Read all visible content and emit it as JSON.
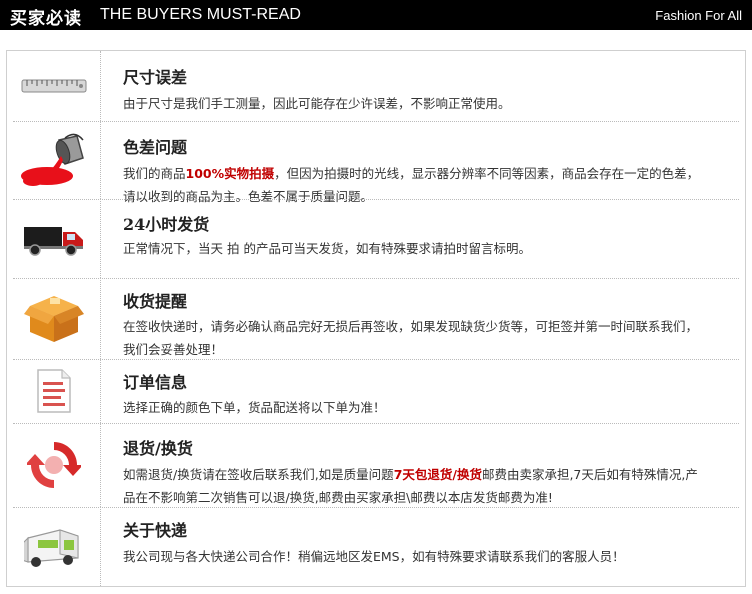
{
  "header": {
    "title_cn": "买家必读",
    "title_en": "THE BUYERS MUST-READ",
    "tagline": "Fashion For All"
  },
  "sections": [
    {
      "icon": "ruler-icon",
      "title": "尺寸误差",
      "desc": "由于尺寸是我们手工测量，因此可能存在少许误差，不影响正常使用。"
    },
    {
      "icon": "paint-can-icon",
      "title": "色差问题",
      "desc_pre": "我们的商品",
      "desc_highlight": "100%实物拍摄",
      "desc_post": "，但因为拍摄时的光线，显示器分辨率不同等因素，商品会存在一定的色差，请以收到的商品为主。色差不属于质量问题。"
    },
    {
      "icon": "truck-icon",
      "title": "24小时发货",
      "desc": "正常情况下，当天 拍 的产品可当天发货，如有特殊要求请拍时留言标明。"
    },
    {
      "icon": "box-icon",
      "title": "收货提醒",
      "desc": "在签收快递时，请务必确认商品完好无损后再签收，如果发现缺货少货等，可拒签并第一时间联系我们，我们会妥善处理！"
    },
    {
      "icon": "document-icon",
      "title": "订单信息",
      "desc": "选择正确的颜色下单，货品配送将以下单为准！"
    },
    {
      "icon": "exchange-arrows-icon",
      "title": "退货/换货",
      "desc_pre": "如需退货/换货请在签收后联系我们,如是质量问题",
      "desc_highlight": "7天包退货/换货",
      "desc_post": "邮费由卖家承担,7天后如有特殊情况,产品在不影响第二次销售可以退/换货,邮费由买家承担\\邮费以本店发货邮费为准!"
    },
    {
      "icon": "delivery-van-icon",
      "title": "关于快递",
      "desc": "我公司现与各大快递公司合作！稍偏远地区发EMS，如有特殊要求请联系我们的客服人员！"
    }
  ],
  "colors": {
    "header_bg": "#000000",
    "highlight": "#c00000",
    "border": "#cfcfcf"
  }
}
